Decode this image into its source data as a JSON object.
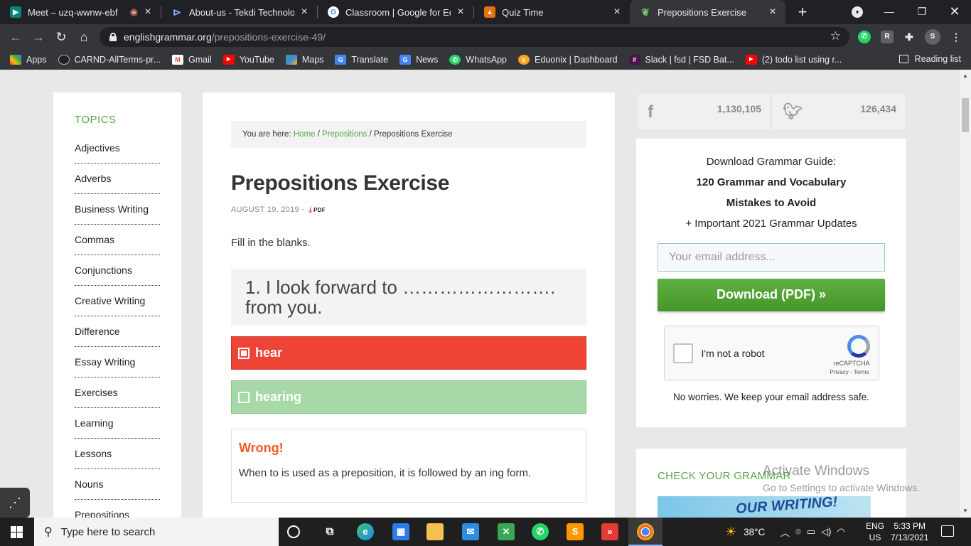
{
  "browser": {
    "tabs": [
      {
        "title": "Meet – uzq-wwnw-ebf",
        "favicon": "meet-icon",
        "active": false
      },
      {
        "title": "About-us - Tekdi Technologie",
        "favicon": "tekdi-icon",
        "active": false
      },
      {
        "title": "Classroom | Google for Educa",
        "favicon": "google-icon",
        "active": false
      },
      {
        "title": "Quiz Time",
        "favicon": "quiz-icon",
        "active": false
      },
      {
        "title": "Prepositions Exercise",
        "favicon": "leaf-icon",
        "active": true
      }
    ],
    "url_domain": "englishgrammar.org",
    "url_path": "/prepositions-exercise-49/",
    "profile_initial": "S",
    "bookmarks": [
      {
        "label": "Apps",
        "icon": "apps-grid-icon"
      },
      {
        "label": "CARND-AllTerms-pr...",
        "icon": "github-icon"
      },
      {
        "label": "Gmail",
        "icon": "gmail-icon"
      },
      {
        "label": "YouTube",
        "icon": "youtube-icon"
      },
      {
        "label": "Maps",
        "icon": "maps-icon"
      },
      {
        "label": "Translate",
        "icon": "translate-icon"
      },
      {
        "label": "News",
        "icon": "news-icon"
      },
      {
        "label": "WhatsApp",
        "icon": "whatsapp-icon"
      },
      {
        "label": "Eduonix | Dashboard",
        "icon": "eduonix-icon"
      },
      {
        "label": "Slack | fsd | FSD Bat...",
        "icon": "slack-icon"
      },
      {
        "label": "(2) todo list using r...",
        "icon": "youtube-icon"
      }
    ],
    "reading_list": "Reading list"
  },
  "sidebar": {
    "heading": "TOPICS",
    "items": [
      "Adjectives",
      "Adverbs",
      "Business Writing",
      "Commas",
      "Conjunctions",
      "Creative Writing",
      "Difference",
      "Essay Writing",
      "Exercises",
      "Learning",
      "Lessons",
      "Nouns",
      "Prepositions"
    ]
  },
  "article": {
    "breadcrumb_prefix": "You are here: ",
    "crumb_home": "Home",
    "crumb_sep": " / ",
    "crumb_category": "Prepositions",
    "crumb_current": "Prepositions Exercise",
    "title": "Prepositions Exercise",
    "date": "AUGUST 19, 2019 -",
    "pdf_label": "PDF",
    "intro": "Fill in the blanks.",
    "question": "1. I look forward to ……………………. from you.",
    "options": [
      {
        "label": "hear",
        "state": "wrong",
        "checked": true
      },
      {
        "label": "hearing",
        "state": "correct",
        "checked": false
      }
    ],
    "feedback_title": "Wrong!",
    "feedback_text": "When to is used as a preposition, it is followed by an ing form."
  },
  "social": {
    "facebook_count": "1,130,105",
    "twitter_count": "126,434"
  },
  "widget": {
    "line1": "Download Grammar Guide:",
    "line2": "120 Grammar and Vocabulary",
    "line3": "Mistakes to Avoid",
    "line4": "+ Important 2021 Grammar Updates",
    "email_placeholder": "Your email address...",
    "download_label": "Download (PDF) »",
    "captcha_label": "I'm not a robot",
    "captcha_brand": "reCAPTCHA",
    "captcha_terms": "Privacy - Terms",
    "safe_note": "No worries. We keep your email address safe."
  },
  "widget2": {
    "title": "CHECK YOUR GRAMMAR",
    "banner_text": "OUR WRITING!"
  },
  "activate": {
    "line1": "Activate Windows",
    "line2": "Go to Settings to activate Windows."
  },
  "taskbar": {
    "search_placeholder": "Type here to search",
    "temperature": "38°C",
    "language": "ENG",
    "region": "US",
    "time": "5:33 PM",
    "date": "7/13/2021"
  }
}
